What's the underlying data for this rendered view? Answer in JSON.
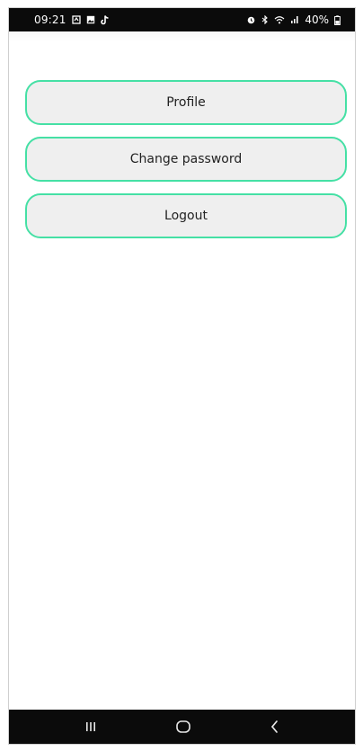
{
  "status_bar": {
    "time": "09:21",
    "battery": "40%",
    "icons": {
      "left": [
        "notification-icon",
        "image-icon",
        "tiktok-icon"
      ],
      "right": [
        "alarm-icon",
        "bluetooth-icon",
        "wifi-icon",
        "signal-icon",
        "battery-icon"
      ]
    }
  },
  "menu": {
    "profile_label": "Profile",
    "change_password_label": "Change password",
    "logout_label": "Logout"
  },
  "nav_bar": {
    "icons": [
      "recent-apps-icon",
      "home-icon",
      "back-icon"
    ]
  },
  "colors": {
    "button_border": "#45e0a5",
    "button_fill": "#efefef",
    "bars": "#0b0b0b"
  }
}
